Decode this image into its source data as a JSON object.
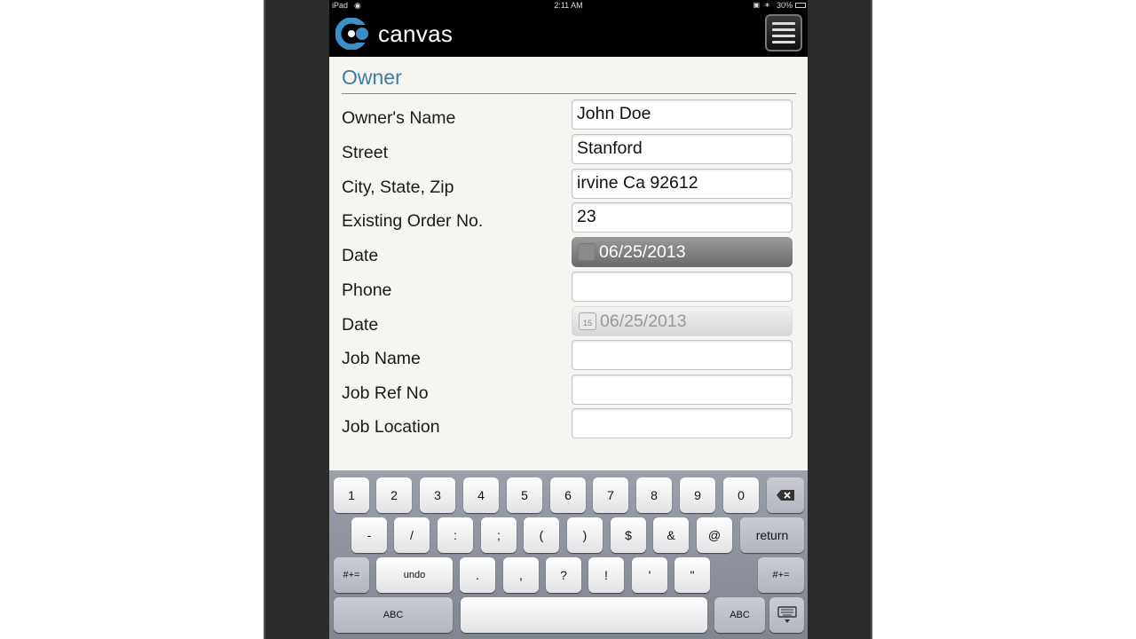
{
  "status_bar": {
    "device": "iPad",
    "time": "2:11 AM",
    "battery": "30%"
  },
  "app": {
    "logo_text": "canvas",
    "brand_color": "#3c8ec4"
  },
  "form": {
    "section_title": "Owner",
    "fields": [
      {
        "label": "Owner's Name",
        "value": "John Doe"
      },
      {
        "label": "Street",
        "value": "Stanford"
      },
      {
        "label": "City, State, Zip",
        "value": "irvine Ca 92612"
      },
      {
        "label": "Existing Order No.",
        "value": "23"
      },
      {
        "label": "Date",
        "value": "06/25/2013"
      },
      {
        "label": "Phone",
        "value": ""
      },
      {
        "label": "Date",
        "value": "06/25/2013"
      },
      {
        "label": "Job Name",
        "value": ""
      },
      {
        "label": "Job Ref No",
        "value": ""
      },
      {
        "label": "Job Location",
        "value": ""
      }
    ],
    "calendar_glyph": "15"
  },
  "keyboard": {
    "row1": [
      "1",
      "2",
      "3",
      "4",
      "5",
      "6",
      "7",
      "8",
      "9",
      "0"
    ],
    "row2": [
      "-",
      "/",
      ":",
      ";",
      "(",
      ")",
      "$",
      "&",
      "@"
    ],
    "return": "return",
    "row3": [
      "#+=",
      "undo",
      ".",
      ",",
      "?",
      "!",
      "'",
      "\"",
      "#+="
    ],
    "abc": "ABC"
  }
}
